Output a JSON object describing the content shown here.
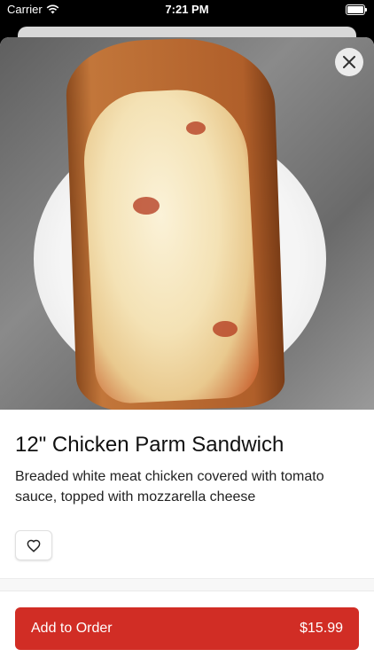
{
  "status_bar": {
    "carrier": "Carrier",
    "time": "7:21 PM"
  },
  "icons": {
    "wifi": "wifi-icon",
    "battery": "battery-icon",
    "close": "close-icon",
    "favorite": "heart-icon"
  },
  "item": {
    "title": "12\" Chicken Parm Sandwich",
    "description": "Breaded white meat chicken covered with tomato sauce, topped with mozzarella cheese"
  },
  "order": {
    "add_label": "Add to Order",
    "price": "$15.99"
  },
  "colors": {
    "accent": "#d12d25",
    "background": "#ffffff",
    "text": "#111111"
  }
}
